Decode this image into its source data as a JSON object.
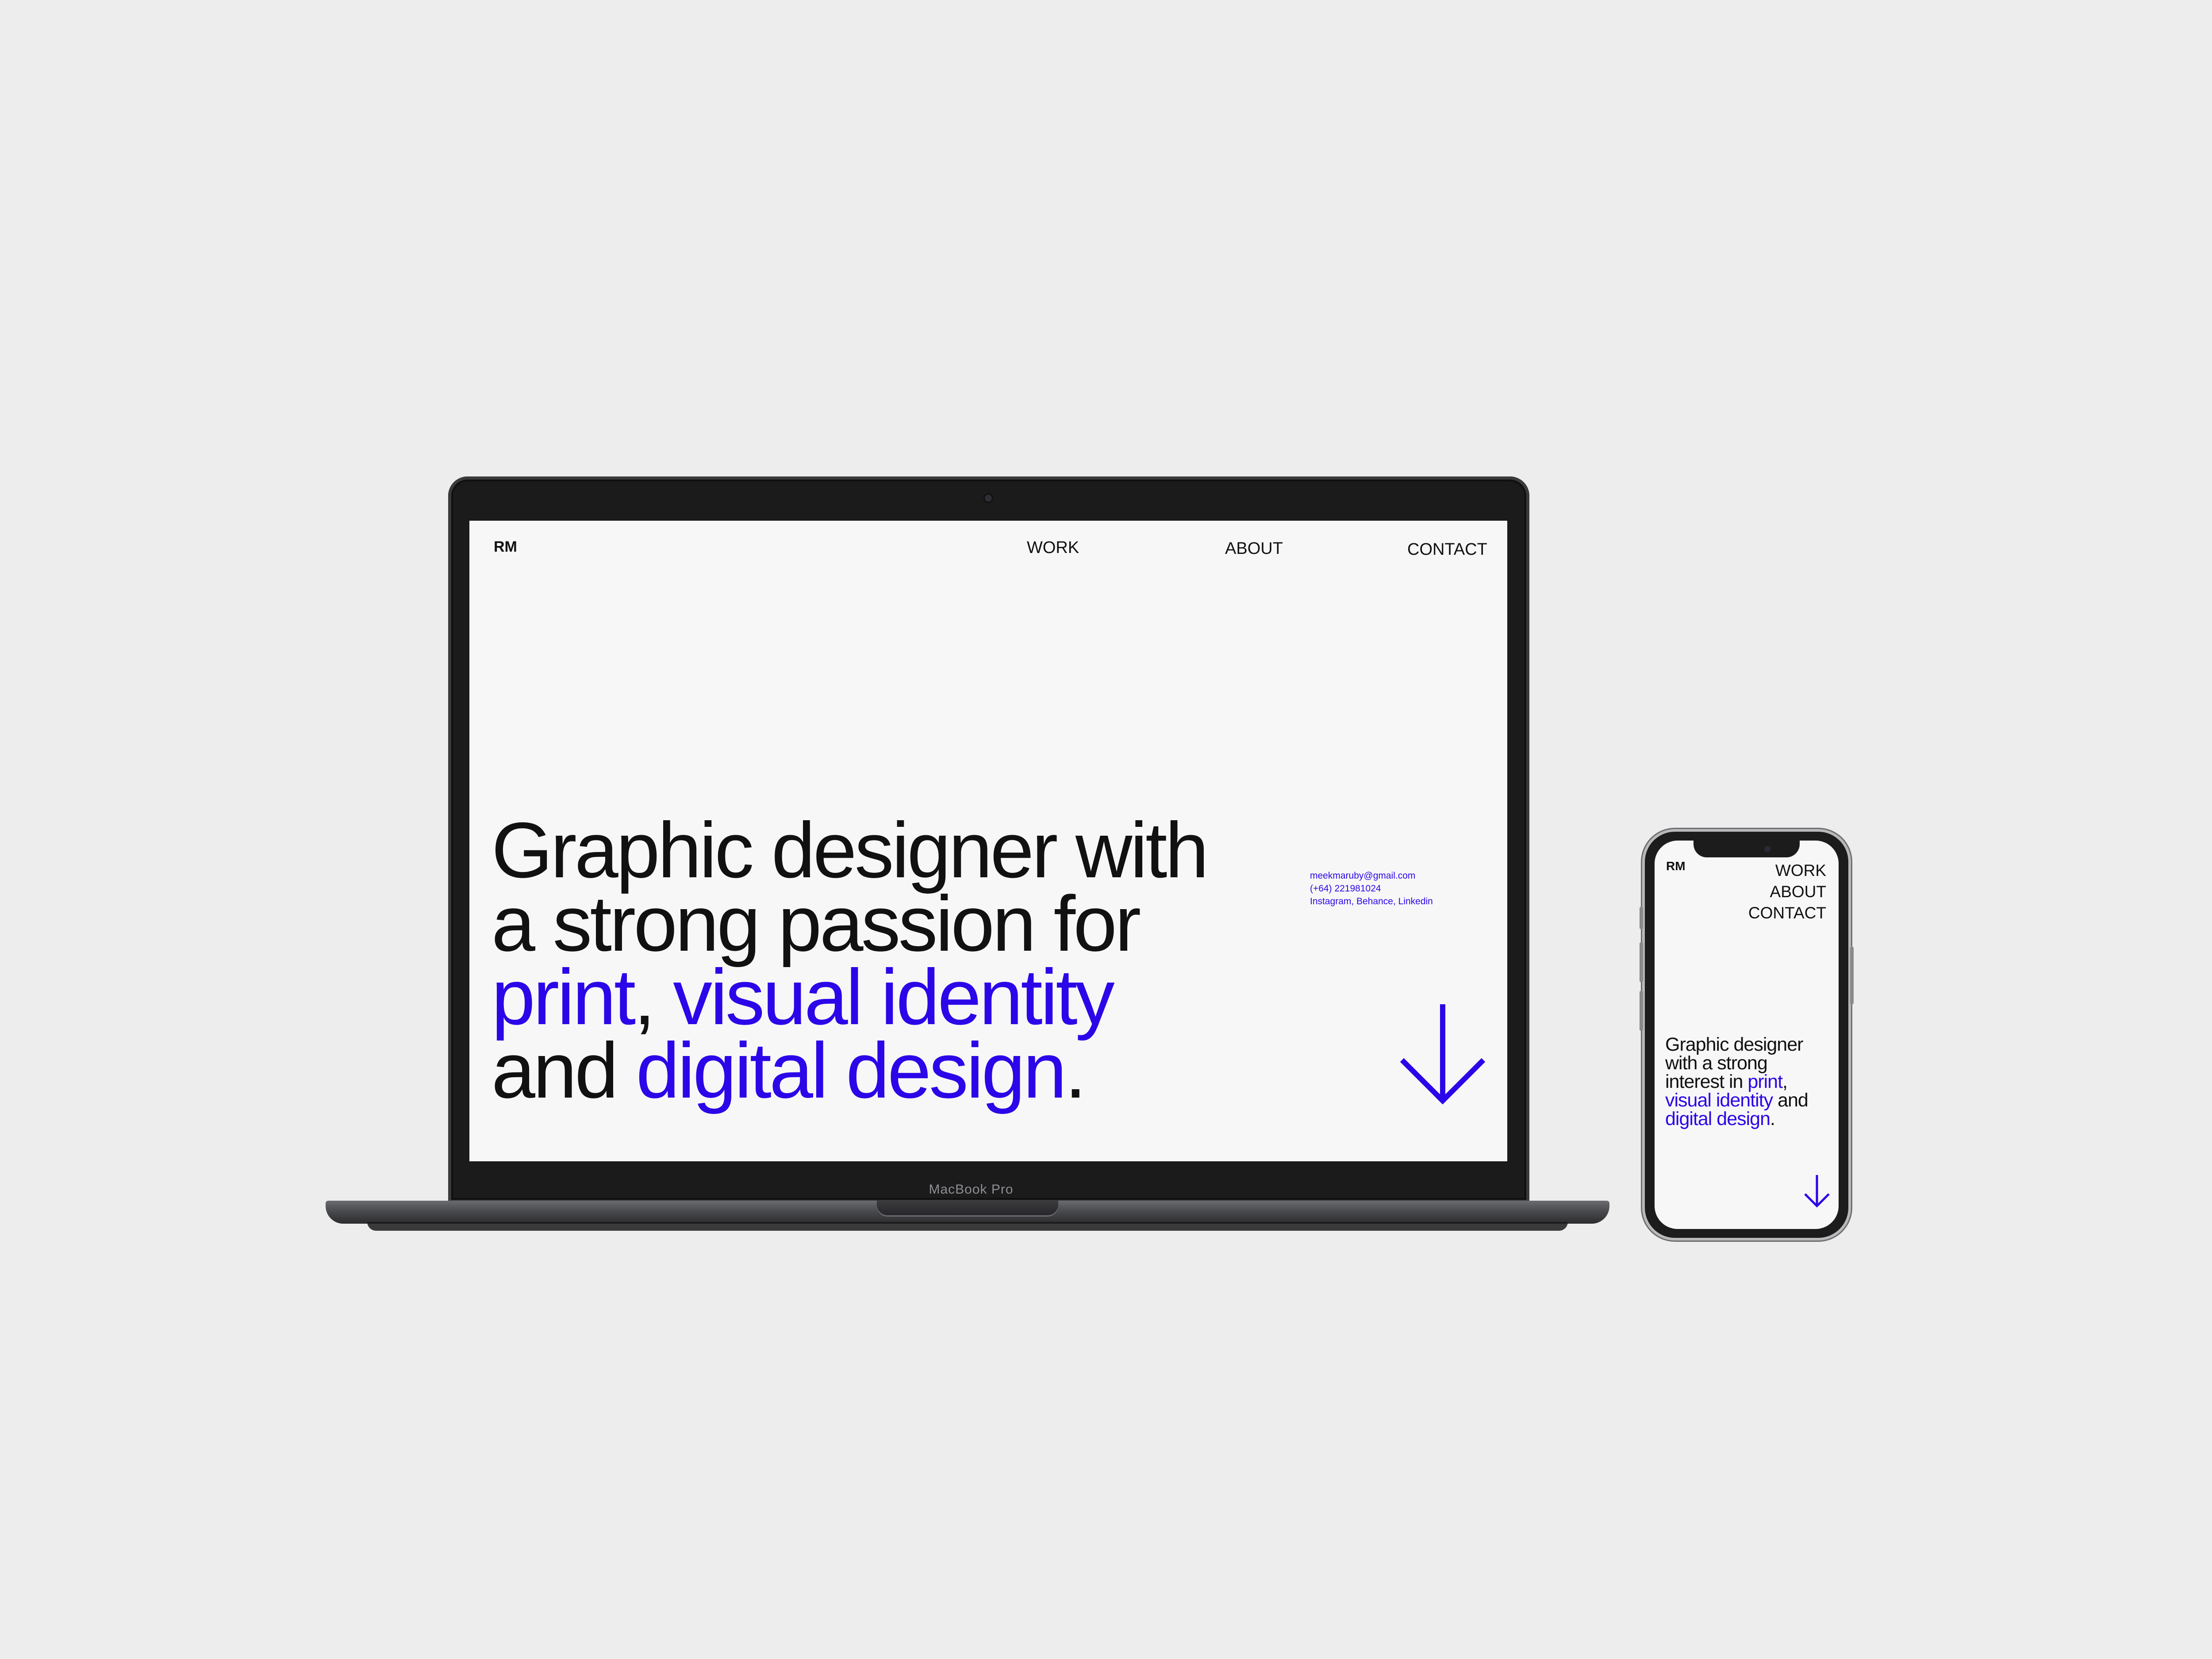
{
  "device_labels": {
    "laptop": "MacBook Pro"
  },
  "site": {
    "logo": "RM",
    "nav": [
      "WORK",
      "ABOUT",
      "CONTACT"
    ],
    "desktop_headline": {
      "line1": "Graphic designer with",
      "line2": "a strong passion for",
      "line3_a": "print",
      "line3_b": ", ",
      "line3_c": "visual identity",
      "line4_a": "and ",
      "line4_b": "digital design",
      "line4_c": "."
    },
    "mobile_headline": {
      "line1": "Graphic designer",
      "line2": "with a strong",
      "line3_a": "interest in ",
      "line3_b": "print",
      "line3_c": ",",
      "line4_a": "visual identity",
      "line4_b": " and",
      "line5_a": "digital design",
      "line5_b": "."
    },
    "contact": {
      "email": "meekmaruby@gmail.com",
      "phone": "(+64) 221981024",
      "socials": "Instagram, Behance, Linkedin"
    }
  },
  "colors": {
    "accent": "#2b06e8",
    "text": "#111111",
    "screen_bg": "#f7f7f7",
    "page_bg": "#ededed"
  },
  "icons": {
    "scroll": "arrow-down-icon"
  }
}
